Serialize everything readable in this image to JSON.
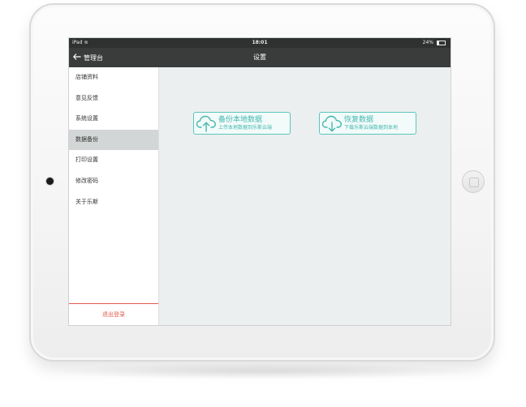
{
  "status_bar": {
    "carrier": "iPad",
    "time": "18:01",
    "battery": "24%",
    "battery_level": 0.24
  },
  "nav": {
    "back_label": "管理台",
    "title": "设置"
  },
  "sidebar": {
    "items": [
      {
        "label": "店铺资料"
      },
      {
        "label": "意见反馈"
      },
      {
        "label": "系统设置"
      },
      {
        "label": "数据备份"
      },
      {
        "label": "打印设置"
      },
      {
        "label": "修改密码"
      },
      {
        "label": "关于乐斯"
      }
    ],
    "active_index": 3,
    "logout_label": "退出登录"
  },
  "actions": {
    "backup": {
      "title": "备份本地数据",
      "subtitle": "上传本地数据到乐斯云端",
      "icon": "cloud-upload-icon"
    },
    "restore": {
      "title": "恢复数据",
      "subtitle": "下载乐斯云端数据到本地",
      "icon": "cloud-download-icon"
    }
  },
  "colors": {
    "accent": "#45b8ae",
    "nav_bg": "#3a3c3c",
    "status_bg": "#2f3131",
    "logout": "#e05b4a",
    "content_bg": "#ecefef",
    "active_item_bg": "#d3d6d6"
  }
}
